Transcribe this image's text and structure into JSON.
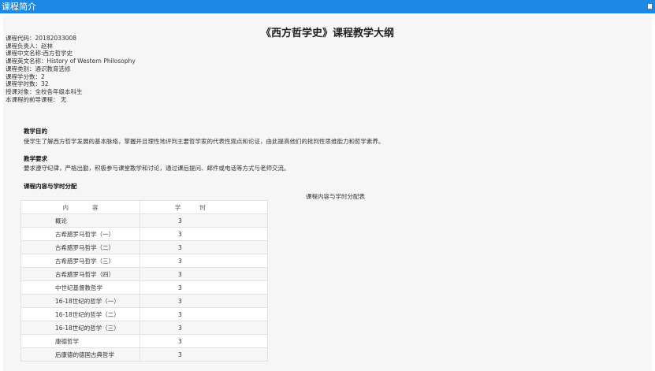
{
  "header": {
    "title": "课程简介"
  },
  "doc": {
    "title": "《西方哲学史》课程教学大纲",
    "info": [
      "课程代码：20182033008",
      "课程负责人：赵林",
      "课程中文名称:西方哲学史",
      "课程英文名称：History of Western Philosophy",
      "课程类别：通识教育选修",
      "课程学分数：2",
      "课程学时数：32",
      "授课对象：全校各年级本科生",
      "本课程的前导课程： 无"
    ],
    "purpose": {
      "heading": "教学目的",
      "text": "使学生了解西方哲学发展的基本脉络，掌握并且理性地评判主要哲学家的代表性观点和论证，由此提高他们的批判性思维能力和哲学素养。"
    },
    "requirements": {
      "heading": "教学要求",
      "text": "要求遵守纪律，严格出勤，积极参与课堂教学和讨论，通过课后提问、邮件或电话等方式与老师交流。"
    },
    "allocation": {
      "heading": "课程内容与学时分配",
      "caption": "课程内容与学时分配表",
      "columns": [
        "内容",
        "学时"
      ],
      "rows": [
        {
          "content": "概论",
          "hours": "3"
        },
        {
          "content": "古希腊罗马哲学（一）",
          "hours": "3"
        },
        {
          "content": "古希腊罗马哲学（二）",
          "hours": "3"
        },
        {
          "content": "古希腊罗马哲学（三）",
          "hours": "3"
        },
        {
          "content": "古希腊罗马哲学（四）",
          "hours": "3"
        },
        {
          "content": "中世纪基督教哲学",
          "hours": "3"
        },
        {
          "content": "16-18世纪的哲学（一）",
          "hours": "3"
        },
        {
          "content": "16-18世纪的哲学（二）",
          "hours": "3"
        },
        {
          "content": "16-18世纪的哲学（三）",
          "hours": "3"
        },
        {
          "content": "康德哲学",
          "hours": "3"
        },
        {
          "content": "后康德的德国古典哲学",
          "hours": "3"
        }
      ]
    }
  }
}
